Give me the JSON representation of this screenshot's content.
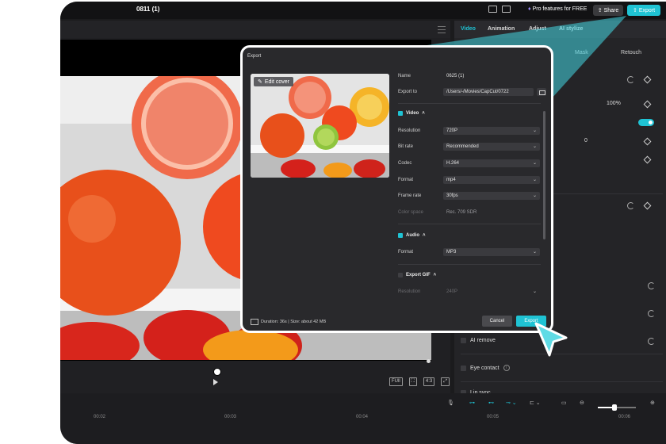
{
  "window": {
    "project_title": "0811 (1)",
    "pro_label": "Pro features for FREE",
    "share_label": "Share",
    "export_label": "Export"
  },
  "right_panel": {
    "tabs": [
      "Video",
      "Animation",
      "Adjust",
      "AI stylize"
    ],
    "active_tab": "Video",
    "sub_tabs": [
      "Mask",
      "Retouch"
    ],
    "opacity_value": "100%",
    "position_y": "0",
    "options": [
      {
        "label": "AI remove"
      },
      {
        "label": "Eye contact"
      },
      {
        "label": "Lip sync"
      }
    ]
  },
  "player": {
    "ratio_label": "4:3",
    "full_label": "FUll"
  },
  "timeline": {
    "ticks": [
      "00:02",
      "00:03",
      "00:04",
      "00:05",
      "00:06"
    ]
  },
  "dialog": {
    "title": "Export",
    "edit_cover_label": "Edit cover",
    "name_label": "Name",
    "name_value": "0625 (1)",
    "export_to_label": "Export to",
    "export_to_value": "/Users/-/Movies/CapCut/0722",
    "video_section": "Video",
    "resolution_label": "Resolution",
    "resolution_value": "720P",
    "bitrate_label": "Bit rate",
    "bitrate_value": "Recommended",
    "codec_label": "Codec",
    "codec_value": "H.264",
    "format_label": "Format",
    "format_value": "mp4",
    "framerate_label": "Frame rate",
    "framerate_value": "30fps",
    "colorspace_label": "Color space",
    "colorspace_value": "Rec. 709 SDR",
    "audio_section": "Audio",
    "audio_format_label": "Format",
    "audio_format_value": "MP3",
    "gif_section": "Export GIF",
    "gif_resolution_label": "Resolution",
    "gif_resolution_value": "240P",
    "footer": "Duration: 36s | Size: about 42 MB",
    "cancel_label": "Cancel",
    "export_label": "Export"
  },
  "colors": {
    "accent": "#1fc3d4",
    "background": "#1b1b1d",
    "dialog": "#29292c"
  }
}
